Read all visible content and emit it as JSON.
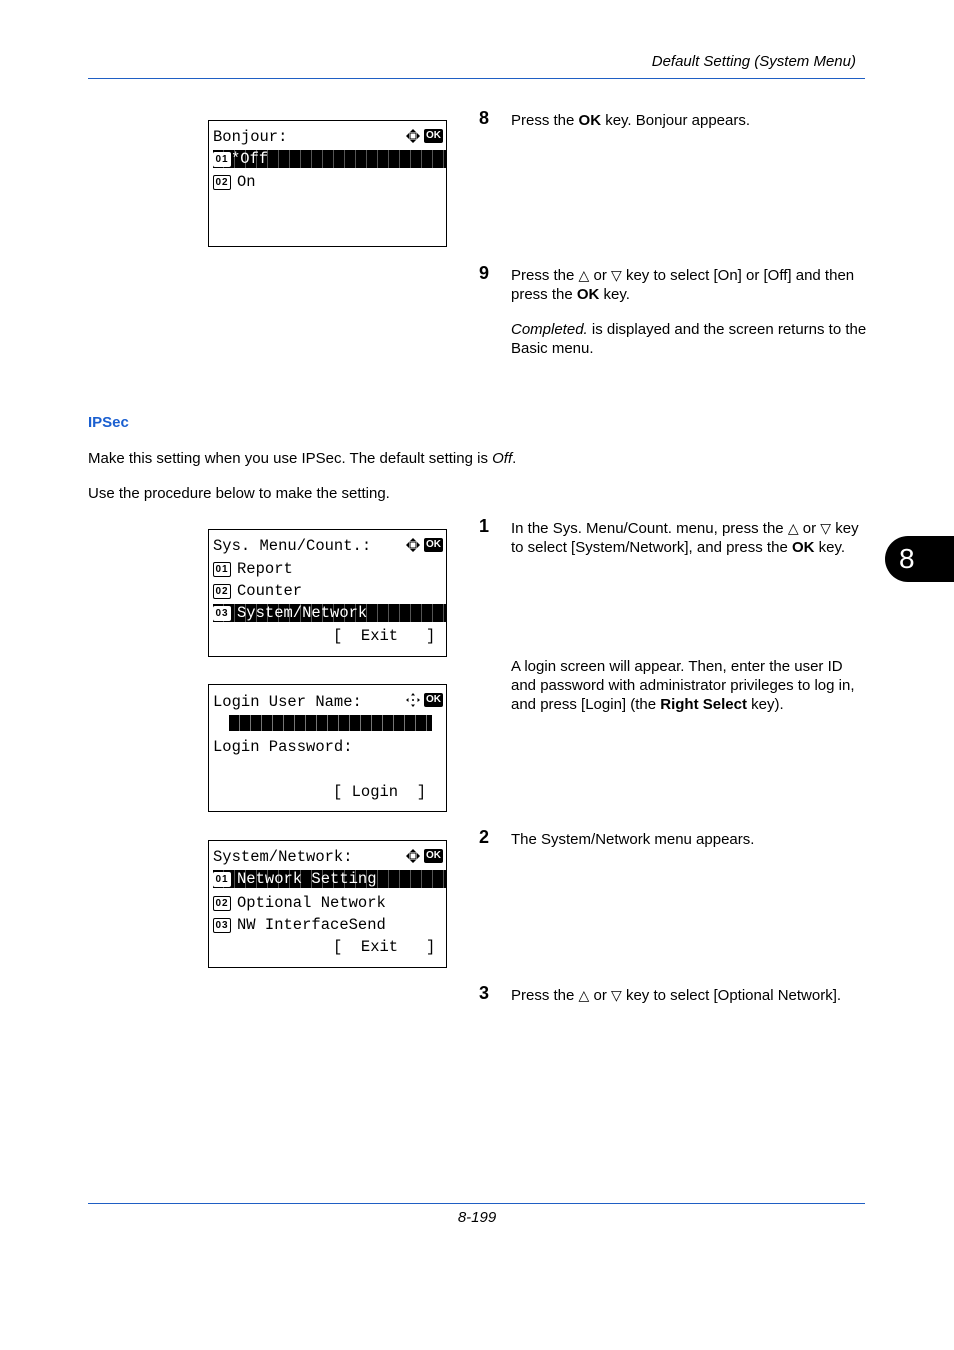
{
  "header": {
    "title": "Default Setting (System Menu)"
  },
  "footer": {
    "page_number": "8-199"
  },
  "chapter_tab": "8",
  "colors": {
    "rule": "#1f5fc4",
    "heading": "#1a5fd0"
  },
  "bonjour_steps": {
    "step8": {
      "num": "8",
      "pre": "Press the ",
      "bold": "OK",
      "post": " key. Bonjour appears."
    },
    "step9": {
      "num": "9",
      "line1_pre": "Press the ",
      "up": "△",
      "or": " or ",
      "down": "▽",
      "line1_post": " key to select [On] or [Off] and then press the ",
      "bold": "OK",
      "line1_end": " key.",
      "note_italic": "Completed.",
      "note_rest": " is displayed and the screen returns to the Basic menu."
    }
  },
  "bonjour_lcd": {
    "title": "Bonjour:",
    "items": [
      {
        "index": "01",
        "label": "*Off",
        "selected": true
      },
      {
        "index": "02",
        "label": "On",
        "selected": false
      }
    ]
  },
  "ipsec": {
    "heading": "IPSec",
    "intro_pre": "Make this setting when you use IPSec. The default setting is ",
    "intro_italic": "Off",
    "intro_end": ".",
    "procedure": "Use the procedure below to make the setting."
  },
  "ipsec_steps": {
    "step1": {
      "num": "1",
      "pre": "In the Sys. Menu/Count. menu, press the ",
      "up": "△",
      "or": " or ",
      "down": "▽",
      "mid": " key to select [System/Network], and press the ",
      "bold": "OK",
      "end": " key.",
      "login_pre": "A login screen will appear. Then, enter the user ID and password with administrator privileges to log in, and press [Login] (the ",
      "login_bold": "Right Select",
      "login_end": " key)."
    },
    "step2": {
      "num": "2",
      "text": "The System/Network menu appears."
    },
    "step3": {
      "num": "3",
      "pre": "Press the ",
      "up": "△",
      "or": " or ",
      "down": "▽",
      "post": " key to select [Optional Network]."
    }
  },
  "sysmenu_lcd": {
    "title": "Sys. Menu/Count.:",
    "items": [
      {
        "index": "01",
        "label": "Report",
        "selected": false
      },
      {
        "index": "02",
        "label": "Counter",
        "selected": false
      },
      {
        "index": "03",
        "label": "System/Network",
        "selected": true
      }
    ],
    "softkey": "[  Exit   ]"
  },
  "login_lcd": {
    "user_label": "Login User Name:",
    "password_label": "Login Password:",
    "softkey": "[ Login  ]"
  },
  "sysnet_lcd": {
    "title": "System/Network:",
    "items": [
      {
        "index": "01",
        "label": "Network Setting",
        "selected": true
      },
      {
        "index": "02",
        "label": "Optional Network",
        "selected": false
      },
      {
        "index": "03",
        "label": "NW InterfaceSend",
        "selected": false
      }
    ],
    "softkey": "[  Exit   ]"
  },
  "lcd_icons": {
    "dpad": "dpad-icon",
    "ok": "OK"
  }
}
